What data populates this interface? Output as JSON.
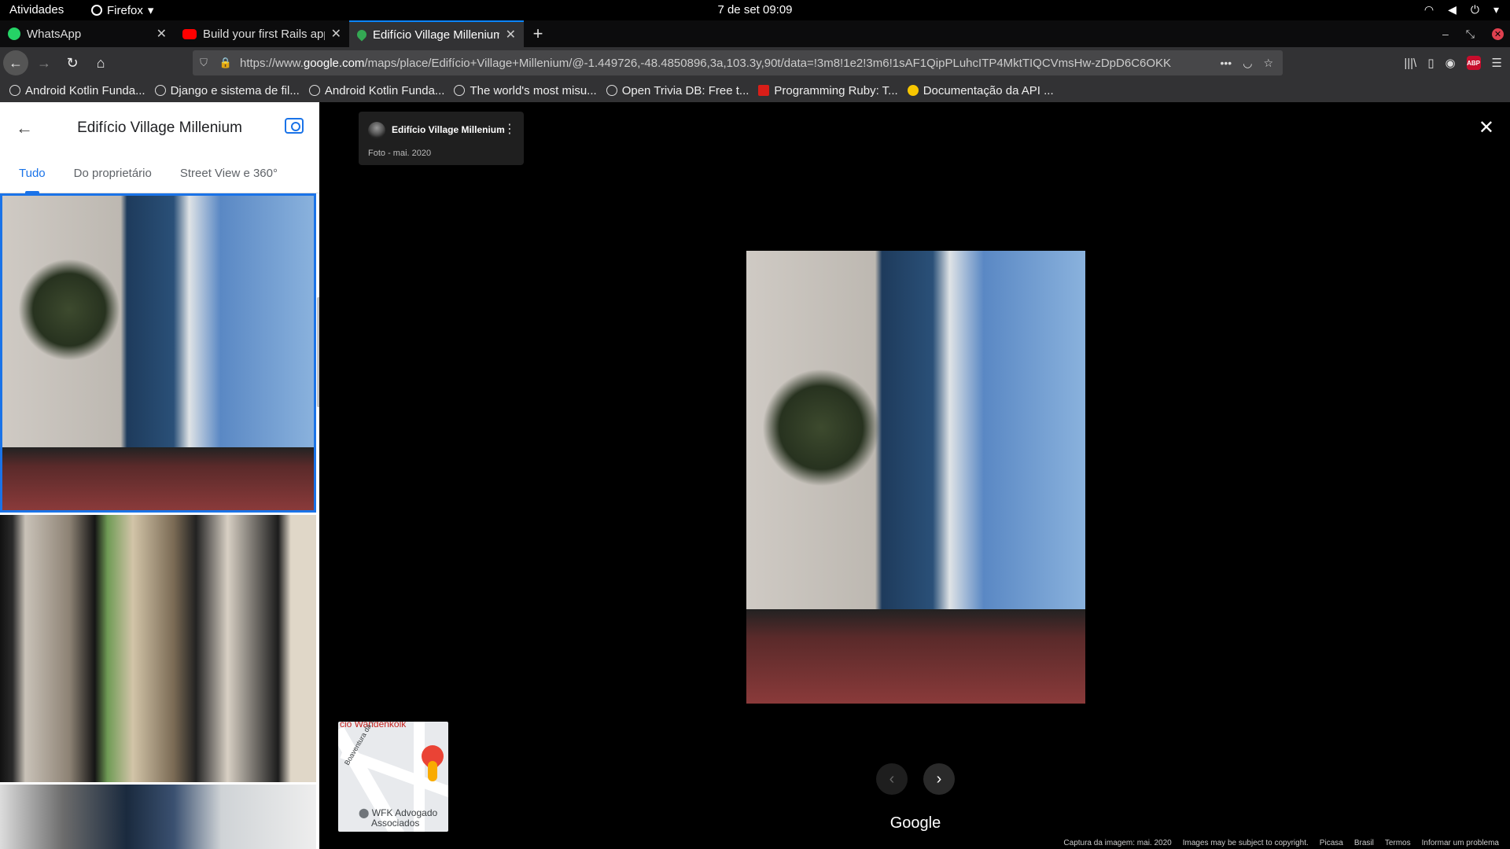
{
  "system": {
    "activities": "Atividades",
    "app": "Firefox",
    "clock": "7 de set  09:09"
  },
  "tabs": [
    {
      "title": "WhatsApp",
      "color": "#25d366"
    },
    {
      "title": "Build your first Rails app",
      "color": "#ff0000"
    },
    {
      "title": "Edifício Village Millenium",
      "color": "#34a853"
    }
  ],
  "url": {
    "prefix": "https://www.",
    "host": "google.com",
    "path": "/maps/place/Edifício+Village+Millenium/@-1.449726,-48.4850896,3a,103.3y,90t/data=!3m8!1e2!3m6!1sAF1QipPLuhcITP4MktTIQCVmsHw-zDpD6C6OKK"
  },
  "bookmarks": [
    "Android Kotlin Funda...",
    "Django e sistema de fil...",
    "Android Kotlin Funda...",
    "The world's most misu...",
    "Open Trivia DB: Free t...",
    "Programming Ruby: T...",
    "Documentação da API ..."
  ],
  "sidebar": {
    "title": "Edifício Village Millenium",
    "tabs": [
      "Tudo",
      "Do proprietário",
      "Street View e 360°"
    ]
  },
  "viewer": {
    "author": "Edifício Village Millenium",
    "date": "Foto - mai. 2020",
    "logo": "Google"
  },
  "minimap": {
    "top_label": "cio Wandenkolk",
    "street": "Boaventura da Silva",
    "place_line1": "WFK Advogado",
    "place_line2": "Associados"
  },
  "footer": [
    "Captura da imagem: mai. 2020",
    "Images may be subject to copyright.",
    "Picasa",
    "Brasil",
    "Termos",
    "Informar um problema"
  ]
}
